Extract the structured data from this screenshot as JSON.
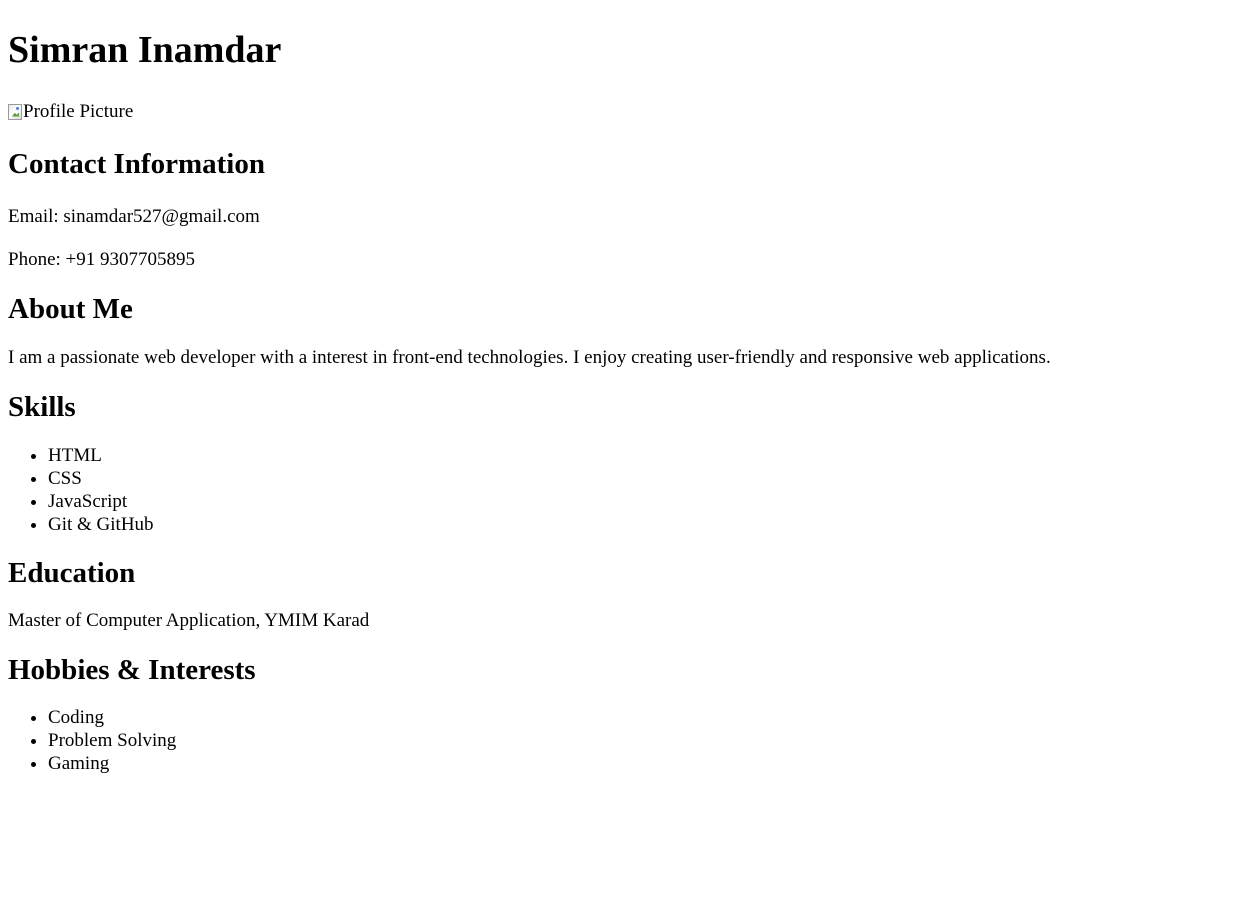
{
  "name": "Simran Inamdar",
  "profile_picture_alt": "Profile Picture",
  "contact": {
    "heading": "Contact Information",
    "email": "Email: sinamdar527@gmail.com",
    "phone": "Phone: +91 9307705895"
  },
  "about": {
    "heading": "About Me",
    "text": "I am a passionate web developer with a interest in front-end technologies. I enjoy creating user-friendly and responsive web applications."
  },
  "skills": {
    "heading": "Skills",
    "items": [
      "HTML",
      "CSS",
      "JavaScript",
      "Git & GitHub"
    ]
  },
  "education": {
    "heading": "Education",
    "text": "Master of Computer Application, YMIM Karad"
  },
  "hobbies": {
    "heading": "Hobbies & Interests",
    "items": [
      "Coding",
      "Problem Solving",
      "Gaming"
    ]
  }
}
